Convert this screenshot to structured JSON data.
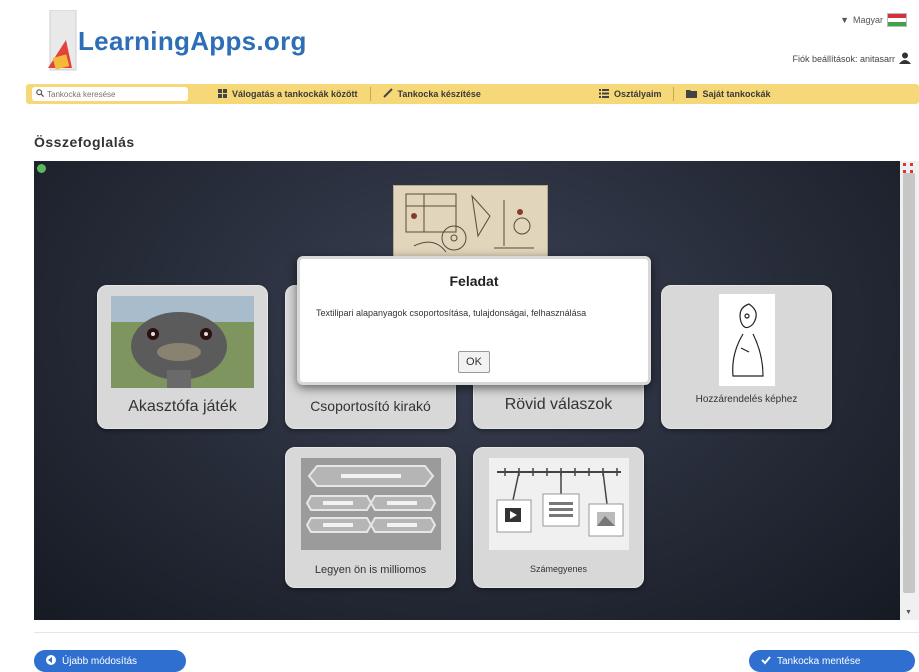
{
  "header": {
    "logo_text": "LearningApps.org",
    "language": "Magyar",
    "account_label": "Fiók beállítások: anitasarr"
  },
  "navbar": {
    "search_placeholder": "Tankocka keresése",
    "items": [
      {
        "label": "Válogatás a tankockák között",
        "icon": "grid-icon"
      },
      {
        "label": "Tankocka készítése",
        "icon": "pencil-icon"
      },
      {
        "label": "Osztályaim",
        "icon": "list-icon"
      },
      {
        "label": "Saját tankockák",
        "icon": "folder-icon"
      }
    ]
  },
  "page": {
    "title": "Összefoglalás"
  },
  "cards": [
    {
      "label": "Akasztófa játék"
    },
    {
      "label": "Csoportosító kirakó"
    },
    {
      "label": "Rövid válaszok"
    },
    {
      "label": "Hozzárendelés képhez"
    },
    {
      "label": "Legyen ön is milliomos"
    },
    {
      "label": "Számegyenes"
    }
  ],
  "dialog": {
    "title": "Feladat",
    "text": "Textilipari alapanyagok csoportosítása, tulajdonságai, felhasználása",
    "ok_label": "OK"
  },
  "footer": {
    "left_button": "Újabb módosítás",
    "right_button": "Tankocka mentése"
  },
  "colors": {
    "navbar": "#f6d878",
    "logo": "#2d6fb6",
    "button_blue": "#2f6fd0",
    "stage_bg": "#262b38"
  }
}
